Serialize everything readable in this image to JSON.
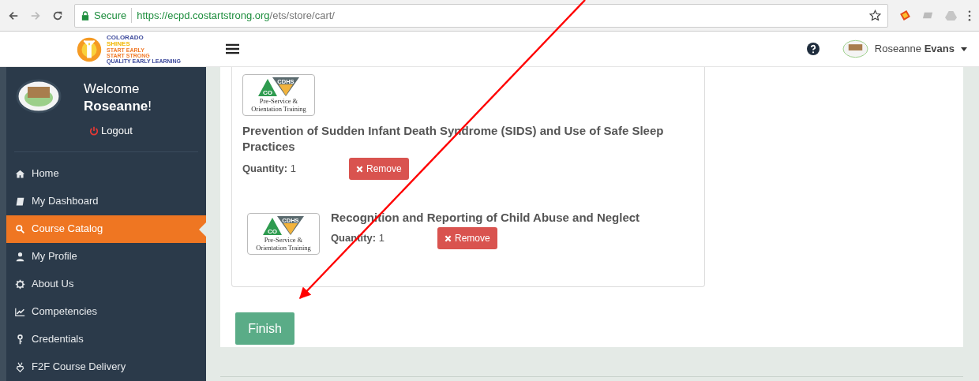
{
  "browser": {
    "secure": "Secure",
    "url_host": "https://ecpd.costartstrong.org",
    "url_path": "/ets/store/cart/"
  },
  "header": {
    "logo_lines": [
      "COLORADO",
      "SHINES",
      "START EARLY",
      "START STRONG",
      "QUALITY EARLY LEARNING"
    ],
    "user_first": "Roseanne",
    "user_last": "Evans"
  },
  "sidebar": {
    "welcome": "Welcome",
    "name": "Roseanne",
    "exclaim": "!",
    "logout": "Logout",
    "items": [
      {
        "label": "Home",
        "selected": false
      },
      {
        "label": "My Dashboard",
        "selected": false
      },
      {
        "label": "Course Catalog",
        "selected": true
      },
      {
        "label": "My Profile",
        "selected": false
      },
      {
        "label": "About Us",
        "selected": false
      },
      {
        "label": "Competencies",
        "selected": false
      },
      {
        "label": "Credentials",
        "selected": false
      },
      {
        "label": "F2F Course Delivery",
        "selected": false
      }
    ]
  },
  "cart": {
    "items": [
      {
        "kind": "stacked",
        "badge": {
          "co": "CO",
          "cdhs": "CDHS",
          "line1": "Pre-Service &",
          "line2": "Orientation Training"
        },
        "title": "Prevention of Sudden Infant Death Syndrome (SIDS) and Use of Safe Sleep Practices",
        "quantity_label": "Quantity:",
        "quantity": "1",
        "remove": "Remove"
      },
      {
        "kind": "inline",
        "badge": {
          "co": "CO",
          "cdhs": "CDHS",
          "line1": "Pre-Service &",
          "line2": "Orientation Training"
        },
        "title": "Recognition and Reporting of Child Abuse and Neglect",
        "quantity_label": "Quantity:",
        "quantity": "1",
        "remove": "Remove"
      }
    ]
  },
  "finish": "Finish"
}
